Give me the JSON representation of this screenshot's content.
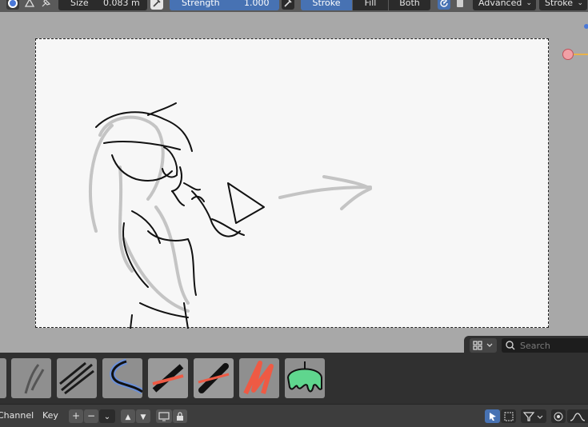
{
  "toolbar": {
    "size_label": "Size",
    "size_value": "0.083 m",
    "strength_label": "Strength",
    "strength_value": "1.000",
    "mode_options": [
      "Stroke",
      "Fill",
      "Both"
    ],
    "mode_selected": "Stroke",
    "advanced_label": "Advanced",
    "stroke_dropdown_label": "Stroke"
  },
  "icons": {
    "pressure_size": "pen-pressure-icon",
    "pressure_strength": "pen-pressure-icon",
    "refresh": "refresh-icon",
    "material": "material-icon",
    "brush_preview": "brush-icon",
    "brush_extra": "brush-settings-icon",
    "pin": "pin-icon"
  },
  "asset_shelf": {
    "search_placeholder": "Search",
    "brushes": [
      "brush-pencil-soft",
      "brush-pencil-hatch",
      "brush-ink-curve",
      "brush-marker-red-black",
      "brush-marker-red-black-2",
      "brush-red-fill",
      "brush-green-drip"
    ]
  },
  "timeline": {
    "channel_label": "Channel",
    "key_label": "Key"
  },
  "colors": {
    "accent": "#4772b3",
    "viewport_bg": "#a8a8a8",
    "canvas_bg": "#f7f7f7",
    "panel_bg": "#303030",
    "header_bg": "#5a5a5a"
  }
}
